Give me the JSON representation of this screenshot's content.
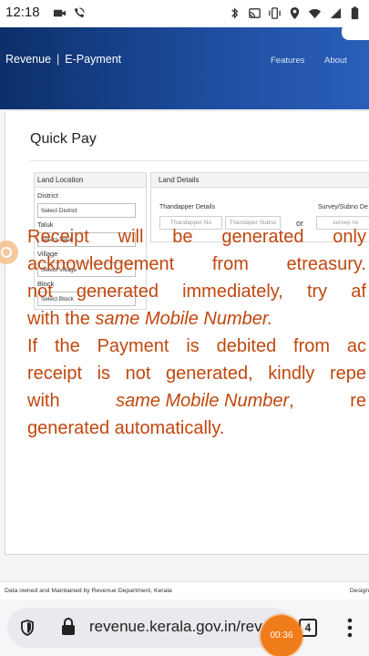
{
  "status_bar": {
    "time": "12:18",
    "left_icons": [
      "video-camera-icon",
      "phone-wifi-icon"
    ],
    "right_icons": [
      "bluetooth-icon",
      "cast-icon",
      "vibrate-icon",
      "location-icon",
      "wifi-icon",
      "signal-icon",
      "battery-icon"
    ]
  },
  "header": {
    "brand_left": "Revenue",
    "brand_sep": "|",
    "brand_right": "E-Payment",
    "nav": {
      "features": "Features",
      "about": "About"
    }
  },
  "quick_pay": {
    "title": "Quick Pay",
    "land_location": {
      "heading": "Land Location",
      "fields": [
        {
          "label": "District",
          "value": "Select District"
        },
        {
          "label": "Taluk",
          "value": "Select Taluk"
        },
        {
          "label": "Village",
          "value": "Select Village"
        },
        {
          "label": "Block",
          "value": "Select Block"
        }
      ]
    },
    "land_details": {
      "heading": "Land Details",
      "thandapper_label": "Thandapper Details",
      "thandapper_no_placeholder": "Thandapper No",
      "thandapper_subno_placeholder": "Thandaper Subno",
      "or": "or",
      "survey_label": "Survey/Subno De",
      "survey_placeholder": "survey no"
    }
  },
  "notice": {
    "l1": [
      "Receipt",
      "will",
      "be",
      "generated",
      "only"
    ],
    "l2": [
      "acknowledgement",
      "from",
      "etreasury."
    ],
    "l3": [
      "not",
      "generated",
      "immediately,",
      "try",
      "af"
    ],
    "l4_pre": "with the ",
    "l4_em": "same Mobile Number.",
    "l5": [
      "If",
      "the",
      "Payment",
      "is",
      "debited",
      "from",
      "ac"
    ],
    "l6": [
      "receipt",
      "is",
      "not",
      "generated,",
      "kindly",
      "repe"
    ],
    "l7_a": "with",
    "l7_em": "same Mobile Number",
    "l7_b": ",",
    "l7_c": "re",
    "l8": "generated automatically."
  },
  "footer": {
    "left": "Data owned and Maintained by Revenue Department, Kerala",
    "right": "Design"
  },
  "browser": {
    "url": "revenue.kerala.gov.in/rev",
    "tab_count": "4",
    "recorder_time": "00:36"
  },
  "colors": {
    "header_start": "#0d2f6a",
    "header_end": "#2a5fb8",
    "notice": "#c0470e",
    "recorder": "#f07c1a"
  }
}
